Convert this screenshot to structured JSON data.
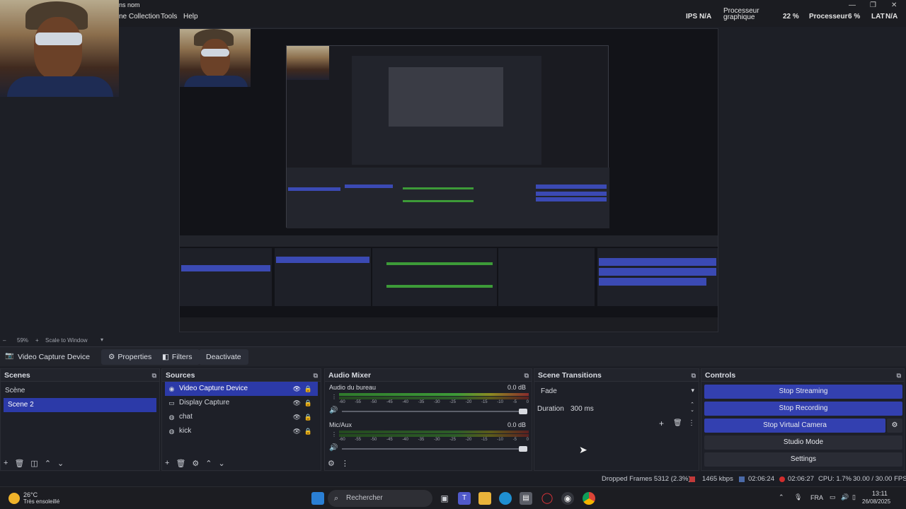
{
  "menubar": {
    "title_fragment": "ns nom",
    "items": [
      "ne Collection",
      "Tools",
      "Help"
    ],
    "hud": {
      "fps_label": "IPS",
      "fps_value": "N/A",
      "gpu_label_line1": "Processeur",
      "gpu_label_line2": "graphique",
      "gpu_value": "22 %",
      "cpu_label": "Processeur",
      "cpu_value": "6 %",
      "latency_label": "LAT",
      "latency_value": "N/A"
    }
  },
  "zoombar": {
    "zoom": "59%",
    "mode": "Scale to Window"
  },
  "source_toolbar": {
    "source_name": "Video Capture Device",
    "properties": "Properties",
    "filters": "Filters",
    "deactivate": "Deactivate"
  },
  "scenes": {
    "title": "Scenes",
    "items": [
      "Scène",
      "Scene 2"
    ],
    "selected_index": 1
  },
  "sources": {
    "title": "Sources",
    "items": [
      {
        "label": "Video Capture Device",
        "icon": "camera-icon"
      },
      {
        "label": "Display Capture",
        "icon": "monitor-icon"
      },
      {
        "label": "chat",
        "icon": "globe-icon"
      },
      {
        "label": "kick",
        "icon": "globe-icon"
      }
    ],
    "selected_index": 0
  },
  "audio_mixer": {
    "title": "Audio Mixer",
    "channels": [
      {
        "name": "Audio du bureau",
        "db": "0.0 dB",
        "level": 0.62
      },
      {
        "name": "Mic/Aux",
        "db": "0.0 dB",
        "level": 0.3
      }
    ],
    "scale": [
      "-60",
      "-55",
      "-50",
      "-45",
      "-40",
      "-35",
      "-30",
      "-25",
      "-20",
      "-15",
      "-10",
      "-5",
      "0"
    ]
  },
  "scene_transitions": {
    "title": "Scene Transitions",
    "transition": "Fade",
    "duration_label": "Duration",
    "duration_value": "300 ms"
  },
  "controls": {
    "title": "Controls",
    "stop_streaming": "Stop Streaming",
    "stop_recording": "Stop Recording",
    "stop_virtual_camera": "Stop Virtual Camera",
    "studio_mode": "Studio Mode",
    "settings": "Settings"
  },
  "statusbar": {
    "dropped_frames": "Dropped Frames 5312 (2.3%)",
    "bitrate": "1465 kbps",
    "stream_time": "02:06:24",
    "record_time": "02:06:27",
    "cpu": "CPU: 1.7%",
    "fps": "30.00 / 30.00 FPS"
  },
  "taskbar": {
    "weather_temp": "26°C",
    "weather_desc": "Très ensoleillé",
    "search_placeholder": "Rechercher",
    "lang": "FRA",
    "time": "13:11",
    "date": "26/08/2025"
  },
  "colors": {
    "accent_blue": "#3340b0",
    "panel_bg": "#1e2028"
  }
}
